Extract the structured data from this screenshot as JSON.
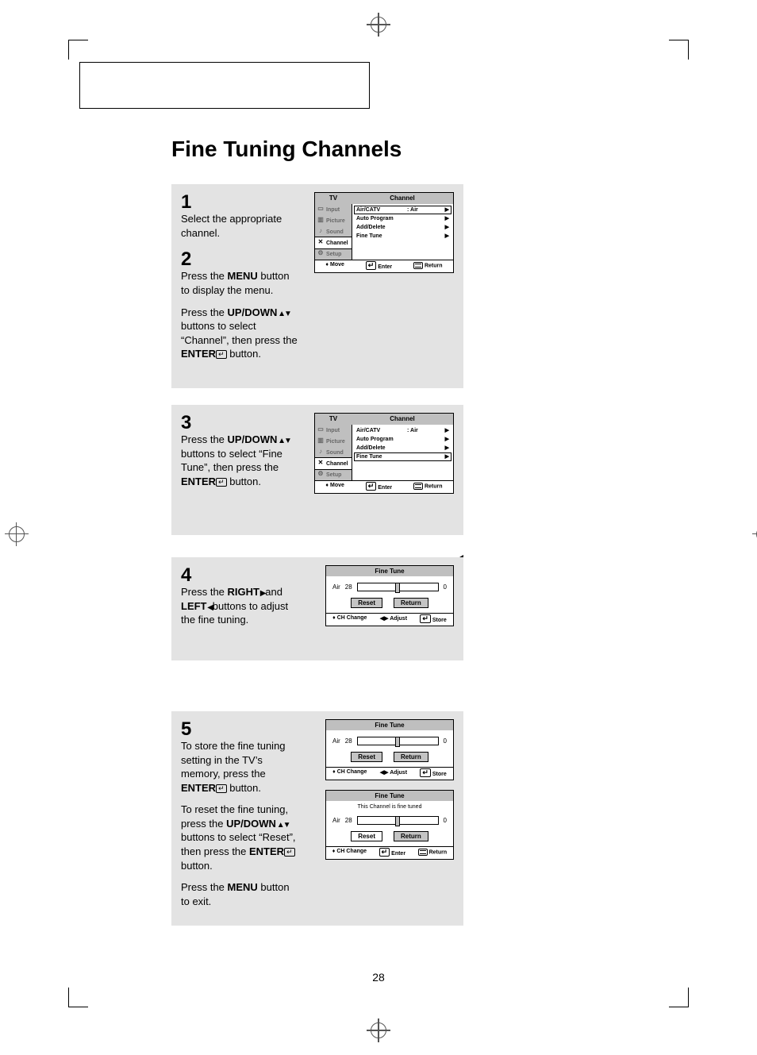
{
  "page_number": "28",
  "title": "Fine Tuning Channels",
  "steps": {
    "s1": {
      "num": "1",
      "text": "Select the appropriate channel."
    },
    "s2": {
      "num": "2",
      "p1_a": "Press the ",
      "p1_b": "MENU",
      "p1_c": " button to display the menu.",
      "p2_a": "Press the ",
      "p2_b": "UP/DOWN",
      "p2_c": " buttons to select “Channel”, then press the ",
      "p2_d": "ENTER",
      "p2_e": " button."
    },
    "s3": {
      "num": "3",
      "p1_a": "Press the ",
      "p1_b": "UP/DOWN",
      "p1_c": " buttons to select “Fine Tune”, then press the ",
      "p1_d": "ENTER",
      "p1_e": " button."
    },
    "s4": {
      "num": "4",
      "p1_a": "Press the ",
      "p1_b": "RIGHT",
      "p1_c": " and ",
      "p1_d": "LEFT",
      "p1_e": " buttons to adjust the fine tuning."
    },
    "s5": {
      "num": "5",
      "p1_a": "To store the fine tuning setting in the TV’s memory, press the ",
      "p1_b": "ENTER",
      "p1_c": " button.",
      "p2_a": "To reset the fine tuning, press the ",
      "p2_b": "UP/DOWN",
      "p2_c": " buttons to select “Reset”, then press the ",
      "p2_d": "ENTER",
      "p2_e": " button.",
      "p3_a": "Press the ",
      "p3_b": "MENU",
      "p3_c": " button to exit."
    }
  },
  "osd_menu": {
    "left_title": "TV",
    "right_title": "Channel",
    "side_items": [
      "Input",
      "Picture",
      "Sound",
      "Channel",
      "Setup"
    ],
    "items": [
      {
        "label": "Air/CATV",
        "value": ": Air"
      },
      {
        "label": "Auto Program",
        "value": ""
      },
      {
        "label": "Add/Delete",
        "value": ""
      },
      {
        "label": "Fine Tune",
        "value": ""
      }
    ],
    "foot": {
      "move": "Move",
      "enter": "Enter",
      "return": "Return"
    },
    "selected_index_a": 0,
    "selected_index_b": 3
  },
  "fine_tune": {
    "title": "Fine Tune",
    "source": "Air",
    "channel": "28",
    "value": "0",
    "reset": "Reset",
    "return": "Return",
    "note_tuned": "This Channel is fine tuned",
    "foot": {
      "chchange": "CH Change",
      "adjust": "Adjust",
      "store": "Store",
      "enter": "Enter",
      "return": "Return"
    }
  }
}
